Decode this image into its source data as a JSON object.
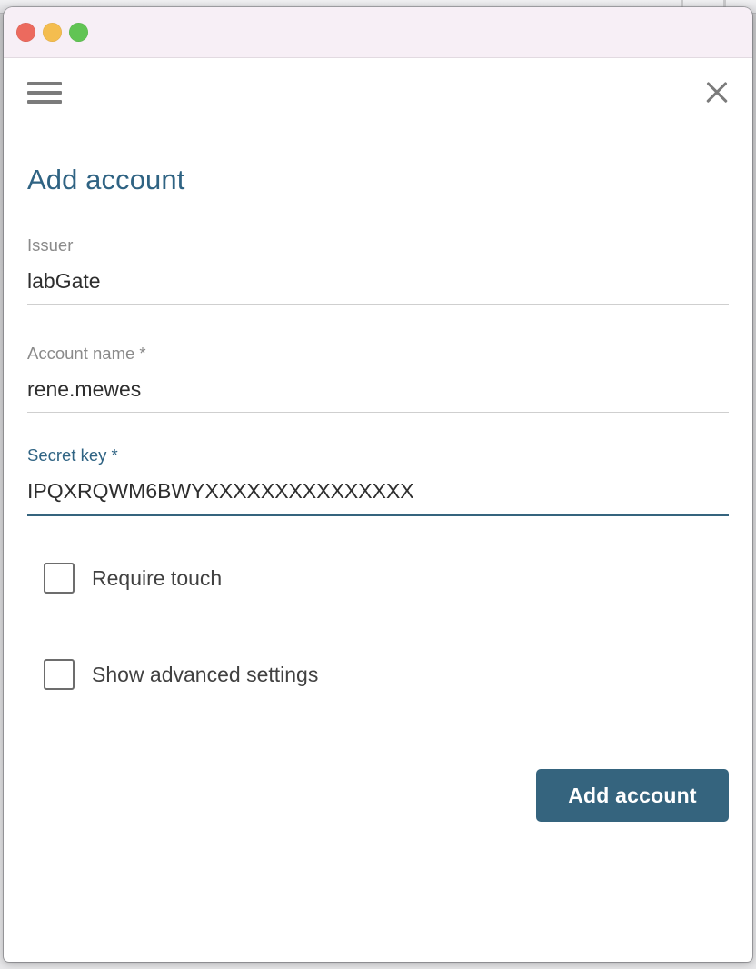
{
  "window": {
    "traffic_lights": [
      {
        "name": "close",
        "color": "#ec6a5e"
      },
      {
        "name": "minimize",
        "color": "#f4bd4f"
      },
      {
        "name": "zoom",
        "color": "#61c454"
      }
    ],
    "titlebar_color": "#f7eff6"
  },
  "toolbar": {
    "menu_icon": "hamburger-menu-icon",
    "close_icon": "close-icon"
  },
  "page": {
    "title": "Add account",
    "title_color": "#2f6383"
  },
  "fields": [
    {
      "key": "issuer",
      "label": "Issuer",
      "value": "labGate",
      "required": false,
      "focused": false,
      "placeholder": "Issuer"
    },
    {
      "key": "account_name",
      "label": "Account name *",
      "value": "rene.mewes",
      "required": true,
      "focused": false,
      "placeholder": "Account name"
    },
    {
      "key": "secret_key",
      "label": "Secret key *",
      "value": "IPQXRQWM6BWYXXXXXXXXXXXXXXX",
      "required": true,
      "focused": true,
      "placeholder": "Secret key"
    }
  ],
  "checkboxes": [
    {
      "key": "require_touch",
      "label": "Require touch",
      "checked": false
    },
    {
      "key": "show_advanced_settings",
      "label": "Show advanced settings",
      "checked": false
    }
  ],
  "actions": {
    "submit_label": "Add account",
    "submit_color": "#35647e"
  }
}
